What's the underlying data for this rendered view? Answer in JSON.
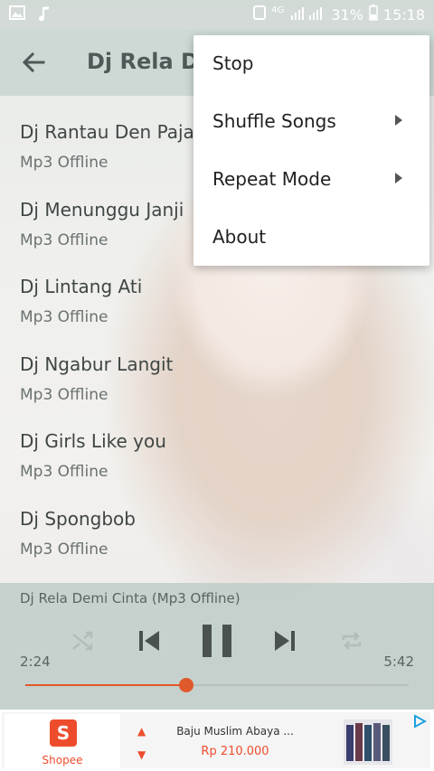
{
  "status_bar": {
    "network": "4G",
    "battery_percent": "31%",
    "time": "15:18"
  },
  "toolbar": {
    "title": "Dj Rela De"
  },
  "songs": [
    {
      "title": "Dj Rantau Den Pajau",
      "subtitle": "Mp3 Offline"
    },
    {
      "title": "Dj Menunggu Janji",
      "subtitle": "Mp3 Offline"
    },
    {
      "title": "Dj Lintang Ati",
      "subtitle": "Mp3 Offline"
    },
    {
      "title": "Dj Ngabur Langit",
      "subtitle": "Mp3 Offline"
    },
    {
      "title": "Dj Girls Like you",
      "subtitle": "Mp3 Offline"
    },
    {
      "title": "Dj Spongbob",
      "subtitle": "Mp3 Offline"
    }
  ],
  "player": {
    "now_playing": "Dj Rela Demi Cinta (Mp3 Offline)",
    "elapsed": "2:24",
    "duration": "5:42",
    "progress_fraction": 0.42,
    "accent": "#e0592b"
  },
  "menu": {
    "items": [
      {
        "label": "Stop",
        "submenu": false
      },
      {
        "label": "Shuffle Songs",
        "submenu": true
      },
      {
        "label": "Repeat Mode",
        "submenu": true
      },
      {
        "label": "About",
        "submenu": false
      }
    ]
  },
  "ad": {
    "brand": "Shopee",
    "brand_color": "#ee4d2d",
    "product_name": "Baju Muslim Abaya ...",
    "product_price": "Rp 210.000"
  }
}
